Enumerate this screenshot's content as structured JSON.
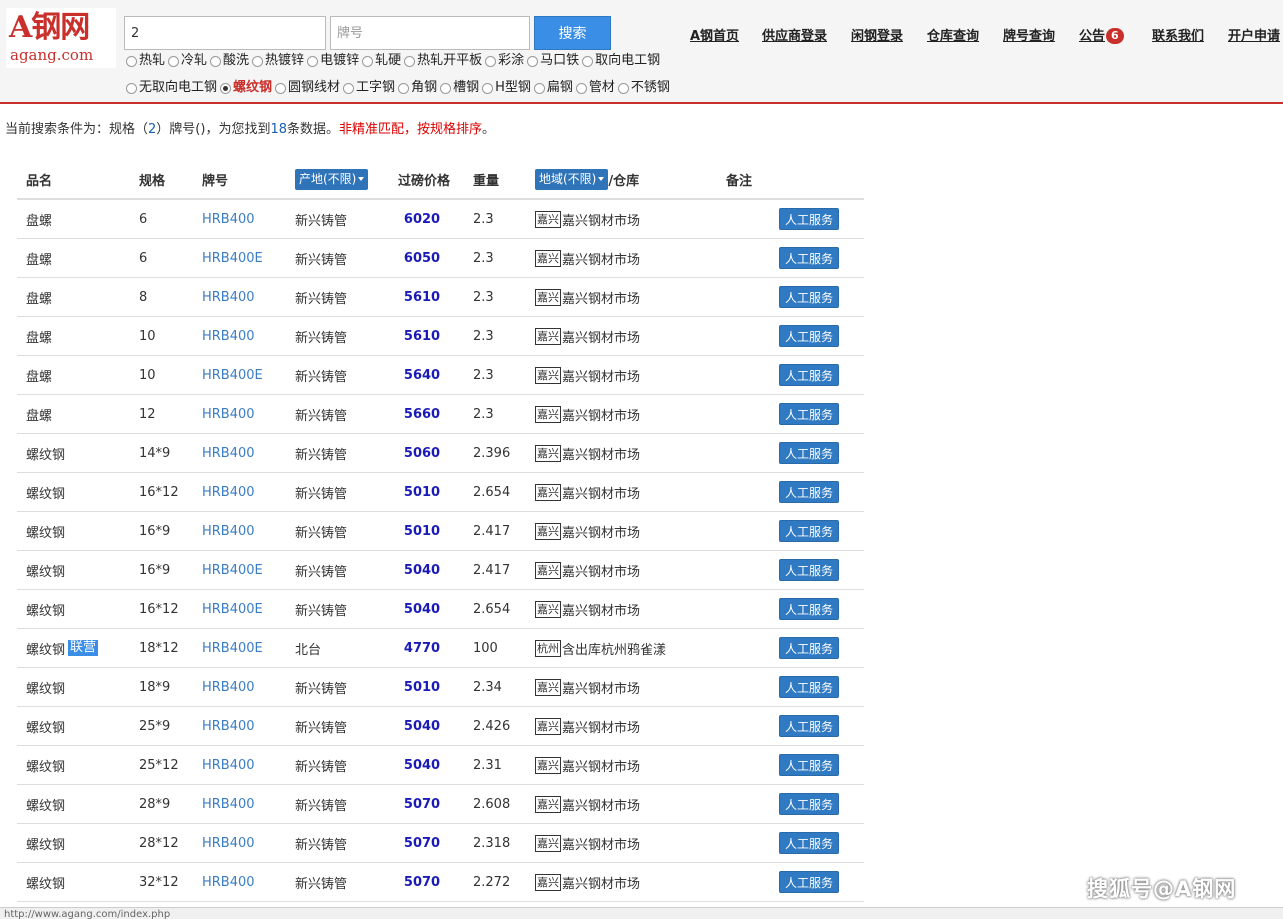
{
  "logo": {
    "main": "A钢网",
    "sub": "agang.com"
  },
  "search": {
    "spec_value": "2",
    "brand_placeholder": "牌号",
    "button_label": "搜索"
  },
  "nav": [
    {
      "label": "A钢首页"
    },
    {
      "label": "供应商登录"
    },
    {
      "label": "闲钢登录"
    },
    {
      "label": "仓库查询"
    },
    {
      "label": "牌号查询"
    },
    {
      "label": "公告",
      "badge": "6"
    },
    {
      "label": "联系我们"
    },
    {
      "label": "开户申请"
    }
  ],
  "categories_row1": [
    "热轧",
    "冷轧",
    "酸洗",
    "热镀锌",
    "电镀锌",
    "轧硬",
    "热轧开平板",
    "彩涂",
    "马口铁",
    "取向电工钢"
  ],
  "categories_row2": [
    "无取向电工钢",
    "螺纹钢",
    "圆钢线材",
    "工字钢",
    "角钢",
    "槽钢",
    "H型钢",
    "扁钢",
    "管材",
    "不锈钢"
  ],
  "selected_category": "螺纹钢",
  "summary": {
    "prefix": "当前搜索条件为：规格（",
    "spec": "2",
    "middle": "）牌号()，为您找到",
    "count": "18",
    "suffix": "条数据。",
    "notice": "非精准匹配，按规格排序",
    "end": "。"
  },
  "table": {
    "headers": {
      "name": "品名",
      "spec": "规格",
      "brand": "牌号",
      "origin_filter": "产地(不限)",
      "price": "过磅价格",
      "weight": "重量",
      "region_filter": "地域(不限)",
      "warehouse_suffix": "/仓库",
      "note": "备注"
    },
    "action_label": "人工服务",
    "rows": [
      {
        "name": "盘螺",
        "tag": "",
        "spec": "6",
        "brand": "HRB400",
        "origin": "新兴铸管",
        "price": "6020",
        "weight": "2.3",
        "region": "嘉兴",
        "warehouse": "嘉兴钢材市场"
      },
      {
        "name": "盘螺",
        "tag": "",
        "spec": "6",
        "brand": "HRB400E",
        "origin": "新兴铸管",
        "price": "6050",
        "weight": "2.3",
        "region": "嘉兴",
        "warehouse": "嘉兴钢材市场"
      },
      {
        "name": "盘螺",
        "tag": "",
        "spec": "8",
        "brand": "HRB400",
        "origin": "新兴铸管",
        "price": "5610",
        "weight": "2.3",
        "region": "嘉兴",
        "warehouse": "嘉兴钢材市场"
      },
      {
        "name": "盘螺",
        "tag": "",
        "spec": "10",
        "brand": "HRB400",
        "origin": "新兴铸管",
        "price": "5610",
        "weight": "2.3",
        "region": "嘉兴",
        "warehouse": "嘉兴钢材市场"
      },
      {
        "name": "盘螺",
        "tag": "",
        "spec": "10",
        "brand": "HRB400E",
        "origin": "新兴铸管",
        "price": "5640",
        "weight": "2.3",
        "region": "嘉兴",
        "warehouse": "嘉兴钢材市场"
      },
      {
        "name": "盘螺",
        "tag": "",
        "spec": "12",
        "brand": "HRB400",
        "origin": "新兴铸管",
        "price": "5660",
        "weight": "2.3",
        "region": "嘉兴",
        "warehouse": "嘉兴钢材市场"
      },
      {
        "name": "螺纹钢",
        "tag": "",
        "spec": "14*9",
        "brand": "HRB400",
        "origin": "新兴铸管",
        "price": "5060",
        "weight": "2.396",
        "region": "嘉兴",
        "warehouse": "嘉兴钢材市场"
      },
      {
        "name": "螺纹钢",
        "tag": "",
        "spec": "16*12",
        "brand": "HRB400",
        "origin": "新兴铸管",
        "price": "5010",
        "weight": "2.654",
        "region": "嘉兴",
        "warehouse": "嘉兴钢材市场"
      },
      {
        "name": "螺纹钢",
        "tag": "",
        "spec": "16*9",
        "brand": "HRB400",
        "origin": "新兴铸管",
        "price": "5010",
        "weight": "2.417",
        "region": "嘉兴",
        "warehouse": "嘉兴钢材市场"
      },
      {
        "name": "螺纹钢",
        "tag": "",
        "spec": "16*9",
        "brand": "HRB400E",
        "origin": "新兴铸管",
        "price": "5040",
        "weight": "2.417",
        "region": "嘉兴",
        "warehouse": "嘉兴钢材市场"
      },
      {
        "name": "螺纹钢",
        "tag": "",
        "spec": "16*12",
        "brand": "HRB400E",
        "origin": "新兴铸管",
        "price": "5040",
        "weight": "2.654",
        "region": "嘉兴",
        "warehouse": "嘉兴钢材市场"
      },
      {
        "name": "螺纹钢",
        "tag": "联营",
        "spec": "18*12",
        "brand": "HRB400E",
        "origin": "北台",
        "price": "4770",
        "weight": "100",
        "region": "杭州",
        "warehouse": "含出库杭州鸦雀漾"
      },
      {
        "name": "螺纹钢",
        "tag": "",
        "spec": "18*9",
        "brand": "HRB400",
        "origin": "新兴铸管",
        "price": "5010",
        "weight": "2.34",
        "region": "嘉兴",
        "warehouse": "嘉兴钢材市场"
      },
      {
        "name": "螺纹钢",
        "tag": "",
        "spec": "25*9",
        "brand": "HRB400",
        "origin": "新兴铸管",
        "price": "5040",
        "weight": "2.426",
        "region": "嘉兴",
        "warehouse": "嘉兴钢材市场"
      },
      {
        "name": "螺纹钢",
        "tag": "",
        "spec": "25*12",
        "brand": "HRB400",
        "origin": "新兴铸管",
        "price": "5040",
        "weight": "2.31",
        "region": "嘉兴",
        "warehouse": "嘉兴钢材市场"
      },
      {
        "name": "螺纹钢",
        "tag": "",
        "spec": "28*9",
        "brand": "HRB400",
        "origin": "新兴铸管",
        "price": "5070",
        "weight": "2.608",
        "region": "嘉兴",
        "warehouse": "嘉兴钢材市场"
      },
      {
        "name": "螺纹钢",
        "tag": "",
        "spec": "28*12",
        "brand": "HRB400",
        "origin": "新兴铸管",
        "price": "5070",
        "weight": "2.318",
        "region": "嘉兴",
        "warehouse": "嘉兴钢材市场"
      },
      {
        "name": "螺纹钢",
        "tag": "",
        "spec": "32*12",
        "brand": "HRB400",
        "origin": "新兴铸管",
        "price": "5070",
        "weight": "2.272",
        "region": "嘉兴",
        "warehouse": "嘉兴钢材市场"
      }
    ]
  },
  "statusbar": {
    "url": "http://www.agang.com/index.php"
  },
  "watermark": "搜狐号@A钢网",
  "colors": {
    "brand_red": "#c9302c",
    "accent_blue": "#3a8ee6",
    "price_blue": "#1a1ab8",
    "link_blue": "#3b7dc4"
  }
}
